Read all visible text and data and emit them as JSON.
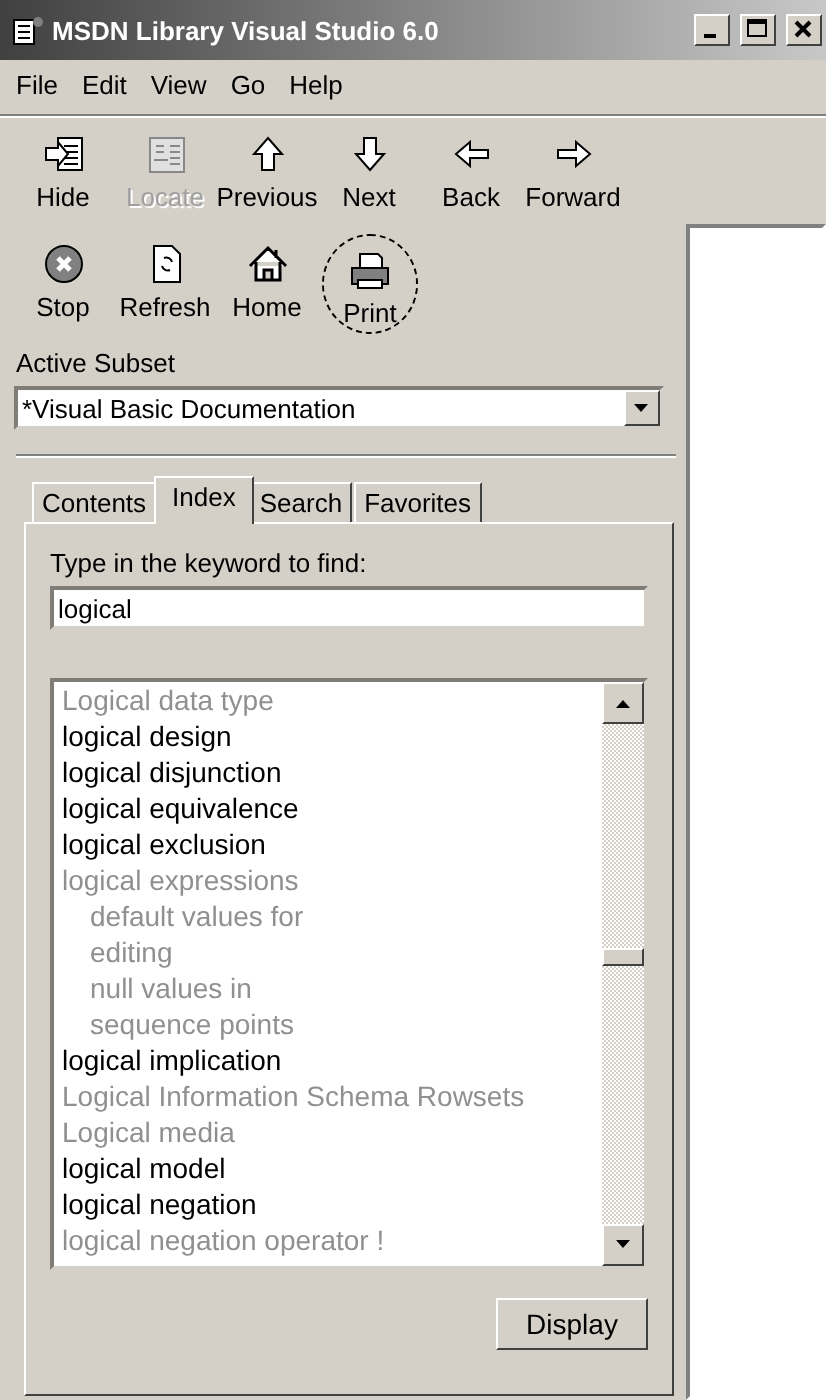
{
  "window": {
    "title": "MSDN Library Visual Studio 6.0"
  },
  "menu": [
    "File",
    "Edit",
    "View",
    "Go",
    "Help"
  ],
  "toolbar": [
    [
      {
        "kind": "hide",
        "label": "Hide",
        "disabled": false,
        "circled": false
      },
      {
        "kind": "locate",
        "label": "Locate",
        "disabled": true,
        "circled": false
      },
      {
        "kind": "up",
        "label": "Previous",
        "disabled": false,
        "circled": false
      },
      {
        "kind": "down",
        "label": "Next",
        "disabled": false,
        "circled": false
      },
      {
        "kind": "left",
        "label": "Back",
        "disabled": false,
        "circled": false
      },
      {
        "kind": "right",
        "label": "Forward",
        "disabled": false,
        "circled": false
      }
    ],
    [
      {
        "kind": "stop",
        "label": "Stop",
        "disabled": false,
        "circled": false
      },
      {
        "kind": "refresh",
        "label": "Refresh",
        "disabled": false,
        "circled": false
      },
      {
        "kind": "home",
        "label": "Home",
        "disabled": false,
        "circled": false
      },
      {
        "kind": "print",
        "label": "Print",
        "disabled": false,
        "circled": true
      }
    ]
  ],
  "subset": {
    "label": "Active Subset",
    "value": "*Visual Basic Documentation"
  },
  "tabs": [
    {
      "label": "Contents",
      "selected": false
    },
    {
      "label": "Index",
      "selected": true
    },
    {
      "label": "Search",
      "selected": false
    },
    {
      "label": "Favorites",
      "selected": false
    }
  ],
  "keyword": {
    "label": "Type in the keyword to find:",
    "value": "logical"
  },
  "index": [
    {
      "text": "Logical data type",
      "dimmed": true
    },
    {
      "text": "logical design",
      "dimmed": false
    },
    {
      "text": "logical disjunction",
      "dimmed": false
    },
    {
      "text": "logical equivalence",
      "dimmed": false
    },
    {
      "text": "logical exclusion",
      "dimmed": false
    },
    {
      "text": "logical expressions",
      "dimmed": true,
      "children": [
        {
          "text": "default values for",
          "dimmed": true
        },
        {
          "text": "editing",
          "dimmed": true
        },
        {
          "text": "null values in",
          "dimmed": true
        },
        {
          "text": "sequence points",
          "dimmed": true
        }
      ]
    },
    {
      "text": "logical implication",
      "dimmed": false
    },
    {
      "text": "Logical Information Schema Rowsets",
      "dimmed": true
    },
    {
      "text": "Logical media",
      "dimmed": true
    },
    {
      "text": "logical model",
      "dimmed": false
    },
    {
      "text": "logical negation",
      "dimmed": false
    },
    {
      "text": "logical negation operator !",
      "dimmed": true
    }
  ],
  "display_button": "Display"
}
